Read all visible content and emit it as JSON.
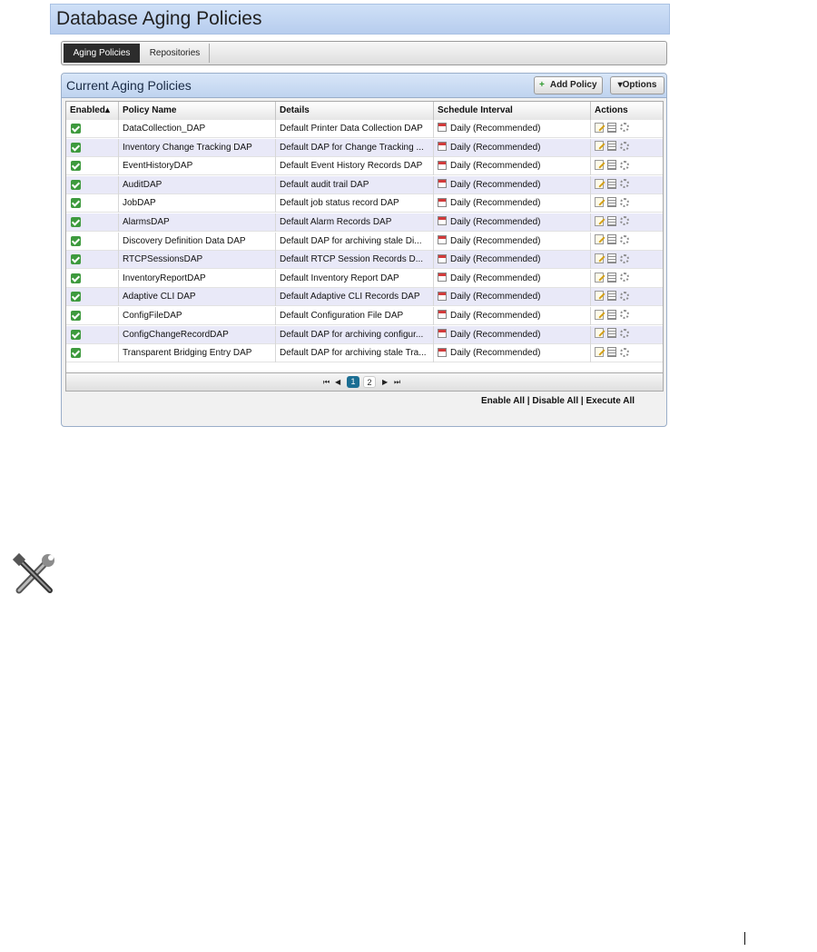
{
  "window": {
    "title": "Database Aging Policies"
  },
  "tabs": [
    {
      "label": "Aging Policies",
      "active": true
    },
    {
      "label": "Repositories",
      "active": false
    }
  ],
  "panel": {
    "title": "Current Aging Policies",
    "add_button": "Add Policy",
    "options_button": "▾Options"
  },
  "table": {
    "columns": [
      "Enabled▴",
      "Policy Name",
      "Details",
      "Schedule Interval",
      "Actions"
    ],
    "rows": [
      {
        "enabled": true,
        "name": "DataCollection_DAP",
        "details": "Default Printer Data Collection DAP",
        "schedule": "Daily (Recommended)"
      },
      {
        "enabled": true,
        "name": "Inventory Change Tracking DAP",
        "details": "Default DAP for Change Tracking ...",
        "schedule": "Daily (Recommended)"
      },
      {
        "enabled": true,
        "name": "EventHistoryDAP",
        "details": "Default Event History Records DAP",
        "schedule": "Daily (Recommended)"
      },
      {
        "enabled": true,
        "name": "AuditDAP",
        "details": "Default audit trail DAP",
        "schedule": "Daily (Recommended)"
      },
      {
        "enabled": true,
        "name": "JobDAP",
        "details": "Default job status record DAP",
        "schedule": "Daily (Recommended)"
      },
      {
        "enabled": true,
        "name": "AlarmsDAP",
        "details": "Default Alarm Records DAP",
        "schedule": "Daily (Recommended)"
      },
      {
        "enabled": true,
        "name": "Discovery Definition Data DAP",
        "details": "Default DAP for archiving stale Di...",
        "schedule": "Daily (Recommended)"
      },
      {
        "enabled": true,
        "name": "RTCPSessionsDAP",
        "details": "Default RTCP Session Records D...",
        "schedule": "Daily (Recommended)"
      },
      {
        "enabled": true,
        "name": "InventoryReportDAP",
        "details": "Default Inventory Report DAP",
        "schedule": "Daily (Recommended)"
      },
      {
        "enabled": true,
        "name": "Adaptive CLI DAP",
        "details": "Default Adaptive CLI Records DAP",
        "schedule": "Daily (Recommended)"
      },
      {
        "enabled": true,
        "name": "ConfigFileDAP",
        "details": "Default Configuration File DAP",
        "schedule": "Daily (Recommended)"
      },
      {
        "enabled": true,
        "name": "ConfigChangeRecordDAP",
        "details": "Default DAP for archiving configur...",
        "schedule": "Daily (Recommended)"
      },
      {
        "enabled": true,
        "name": "Transparent Bridging Entry DAP",
        "details": "Default DAP for archiving stale Tra...",
        "schedule": "Daily (Recommended)"
      }
    ],
    "action_icons": [
      "edit-icon",
      "details-icon",
      "execute-gear-icon"
    ]
  },
  "pagination": {
    "first": "⏮",
    "prev": "◀",
    "next": "▶",
    "last": "⏭",
    "pages": [
      "1",
      "2"
    ],
    "current": "1"
  },
  "footer": {
    "enable_all": "Enable All",
    "disable_all": "Disable All",
    "execute_all": "Execute All",
    "separator": " | "
  },
  "colors": {
    "title_bar": "#b7cdee",
    "active_tab": "#2c2c2c",
    "row_alt": "#e9e9f8",
    "checkbox": "#3e9a3e",
    "current_page": "#1b6e93"
  }
}
